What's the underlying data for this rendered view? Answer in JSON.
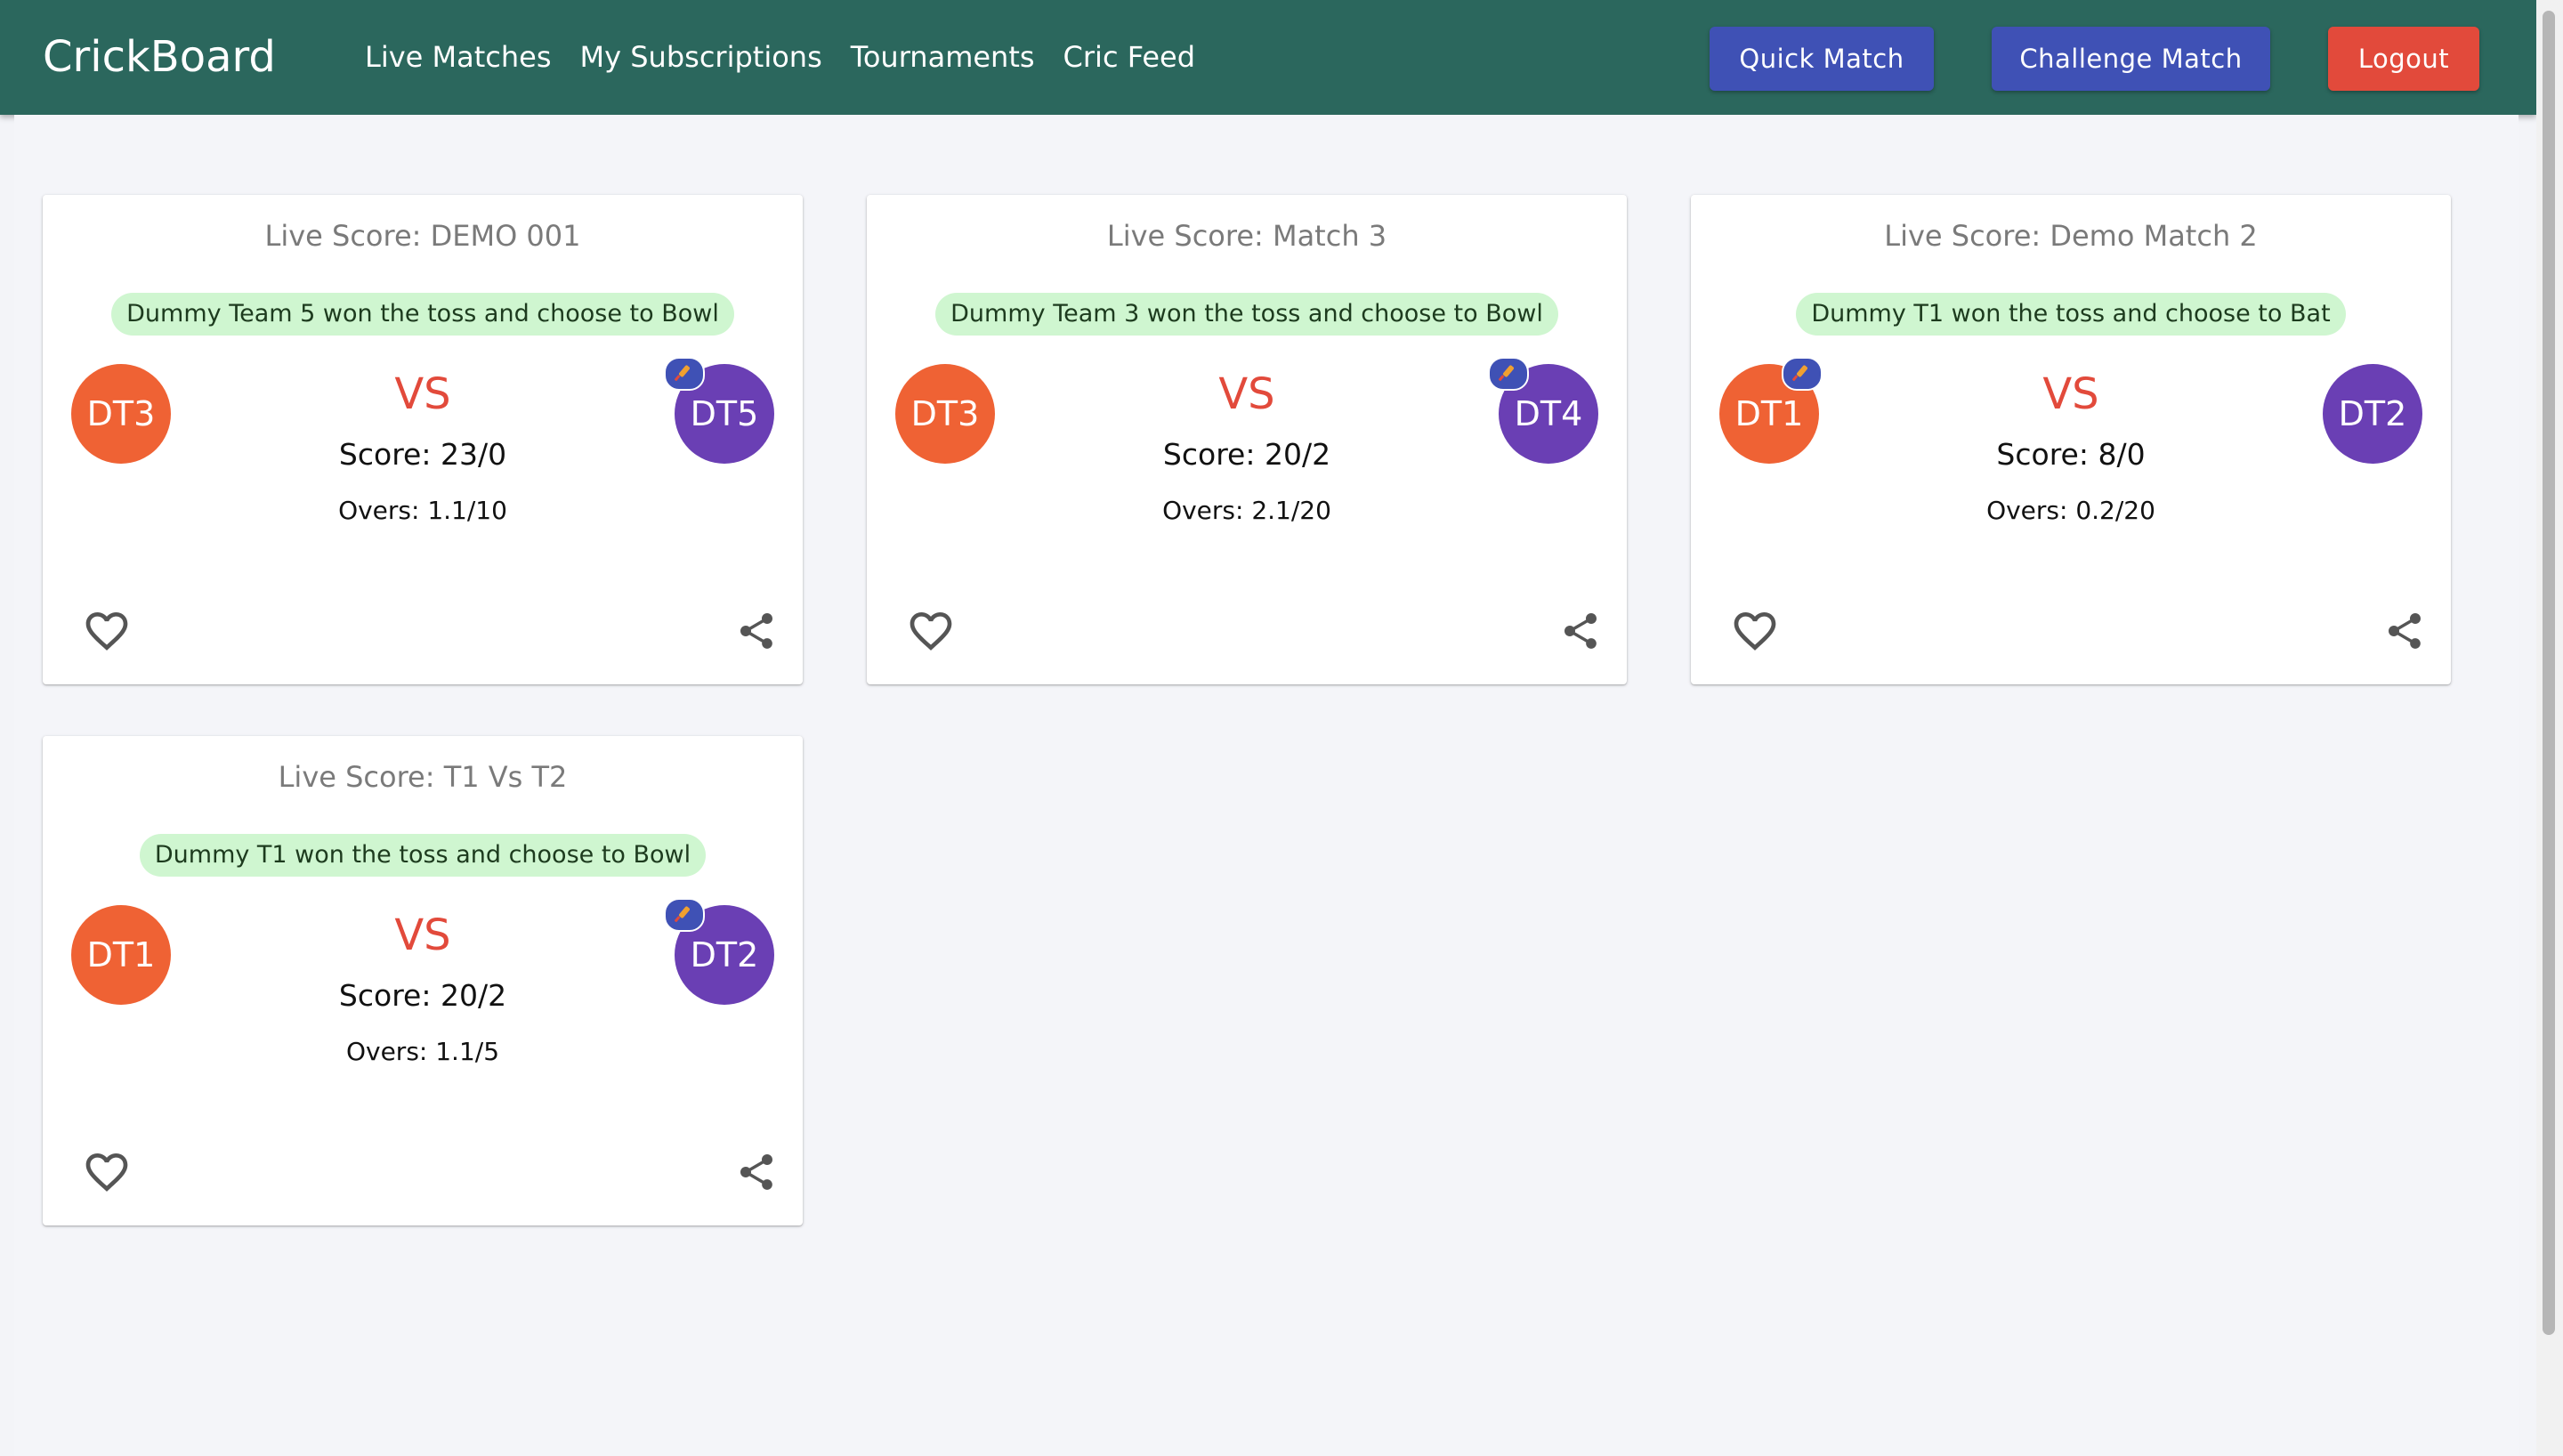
{
  "app": {
    "title": "CrickBoard"
  },
  "nav": [
    "Live Matches",
    "My Subscriptions",
    "Tournaments",
    "Cric Feed"
  ],
  "actions": {
    "quick_match": "Quick Match",
    "challenge_match": "Challenge Match",
    "logout": "Logout"
  },
  "colors": {
    "header": "#2b675d",
    "primary": "#3f51b5",
    "danger": "#e24a3b",
    "team_a": "#ef6234",
    "team_b": "#6a3fb4",
    "toss_bg": "#cff6d0"
  },
  "icons": {
    "favorite": "heart-outline-icon",
    "share": "share-icon",
    "batting": "cricket-bat-icon"
  },
  "matches": [
    {
      "title": "Live Score: DEMO 001",
      "toss": "Dummy Team 5 won the toss and choose to Bowl",
      "team_a": "DT3",
      "team_b": "DT5",
      "batting": "b",
      "vs": "VS",
      "score": "Score: 23/0",
      "overs": "Overs: 1.1/10"
    },
    {
      "title": "Live Score: Match 3",
      "toss": "Dummy Team 3 won the toss and choose to Bowl",
      "team_a": "DT3",
      "team_b": "DT4",
      "batting": "b",
      "vs": "VS",
      "score": "Score: 20/2",
      "overs": "Overs: 2.1/20"
    },
    {
      "title": "Live Score: Demo Match 2",
      "toss": "Dummy T1 won the toss and choose to Bat",
      "team_a": "DT1",
      "team_b": "DT2",
      "batting": "a",
      "vs": "VS",
      "score": "Score: 8/0",
      "overs": "Overs: 0.2/20"
    },
    {
      "title": "Live Score: T1 Vs T2",
      "toss": "Dummy T1 won the toss and choose to Bowl",
      "team_a": "DT1",
      "team_b": "DT2",
      "batting": "b",
      "vs": "VS",
      "score": "Score: 20/2",
      "overs": "Overs: 1.1/5"
    }
  ]
}
